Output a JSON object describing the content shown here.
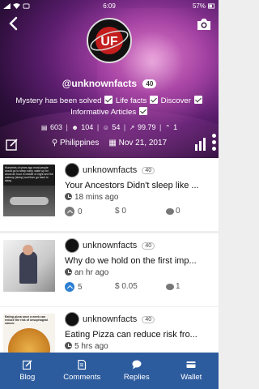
{
  "status_bar": {
    "time": "6:09",
    "battery": "57%"
  },
  "profile": {
    "username": "@unknownfacts",
    "level": "40",
    "bio_parts": [
      "Mystery has been solved",
      "Life facts",
      "Discover",
      "Informative Articles"
    ],
    "stats": {
      "posts": "603",
      "following": "104",
      "followers": "54",
      "voting_power": "99.79",
      "votes": "1"
    },
    "location": "Philippines",
    "joined": "Nov 21, 2017",
    "avatar_letters": "UF"
  },
  "posts": [
    {
      "author": "unknownfacts",
      "level": "40",
      "title": "Your Ancestors Didn't sleep like ...",
      "time": "18 mins ago",
      "votes": "0",
      "payout": "$ 0",
      "comments": "0",
      "vote_active": false,
      "thumb_caption": "Hundreds of years ago most people would go to sleep early, wake up for about an hour in middle of night and the wakeup (sleep) and then go back to sleep."
    },
    {
      "author": "unknownfacts",
      "level": "40",
      "title": "Why do we hold on the first imp...",
      "time": "an hr ago",
      "votes": "5",
      "payout": "$ 0.05",
      "comments": "1",
      "vote_active": true,
      "thumb_caption": ""
    },
    {
      "author": "unknownfacts",
      "level": "40",
      "title": "Eating Pizza can reduce risk fro...",
      "time": "5 hrs ago",
      "votes": "",
      "payout": "",
      "comments": "",
      "vote_active": false,
      "thumb_caption": "Eating pizza once a week can reduce the risk of oesophageal cancer."
    }
  ],
  "nav": [
    {
      "label": "Blog",
      "icon": "pencil-icon"
    },
    {
      "label": "Comments",
      "icon": "document-icon"
    },
    {
      "label": "Replies",
      "icon": "chat-bubble-icon"
    },
    {
      "label": "Wallet",
      "icon": "wallet-icon"
    }
  ],
  "colors": {
    "nav_bg": "#2d5c9e",
    "vote_active": "#2d7fd2",
    "hero_purple": "#9b3c9e"
  }
}
